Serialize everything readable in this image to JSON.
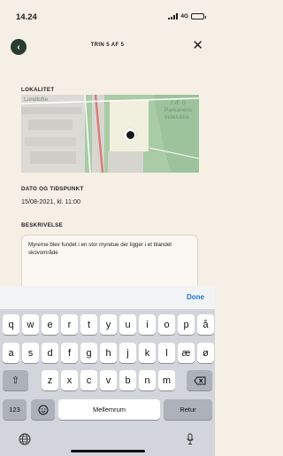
{
  "status": {
    "time": "14.24",
    "network": "4G"
  },
  "header": {
    "title": "TRIN 5 AF 5"
  },
  "location": {
    "label": "LOKALITET",
    "map_labels": [
      "Lundtofte",
      "J Æ G",
      "Parkanens",
      "Indelukke"
    ]
  },
  "datetime": {
    "label": "DATO OG TIDSPUNKT",
    "value": "15/08-2021, kl. 11:00"
  },
  "description": {
    "label": "BESKRIVELSE",
    "text": "Myrerne blev fundet i en stor myretue der ligger i et blandet skovområde"
  },
  "keyboard": {
    "done": "Done",
    "row1": [
      "q",
      "w",
      "e",
      "r",
      "t",
      "y",
      "u",
      "i",
      "o",
      "p",
      "å"
    ],
    "row2": [
      "a",
      "s",
      "d",
      "f",
      "g",
      "h",
      "j",
      "k",
      "l",
      "æ",
      "ø"
    ],
    "row3": [
      "z",
      "x",
      "c",
      "v",
      "b",
      "n",
      "m"
    ],
    "numbers_key": "123",
    "space_key": "Mellemrum",
    "return_key": "Retur"
  },
  "colors": {
    "background": "#f5efe6",
    "accent": "#2b3c31",
    "link": "#1b74d6",
    "map_green": "#a6c9a5"
  }
}
